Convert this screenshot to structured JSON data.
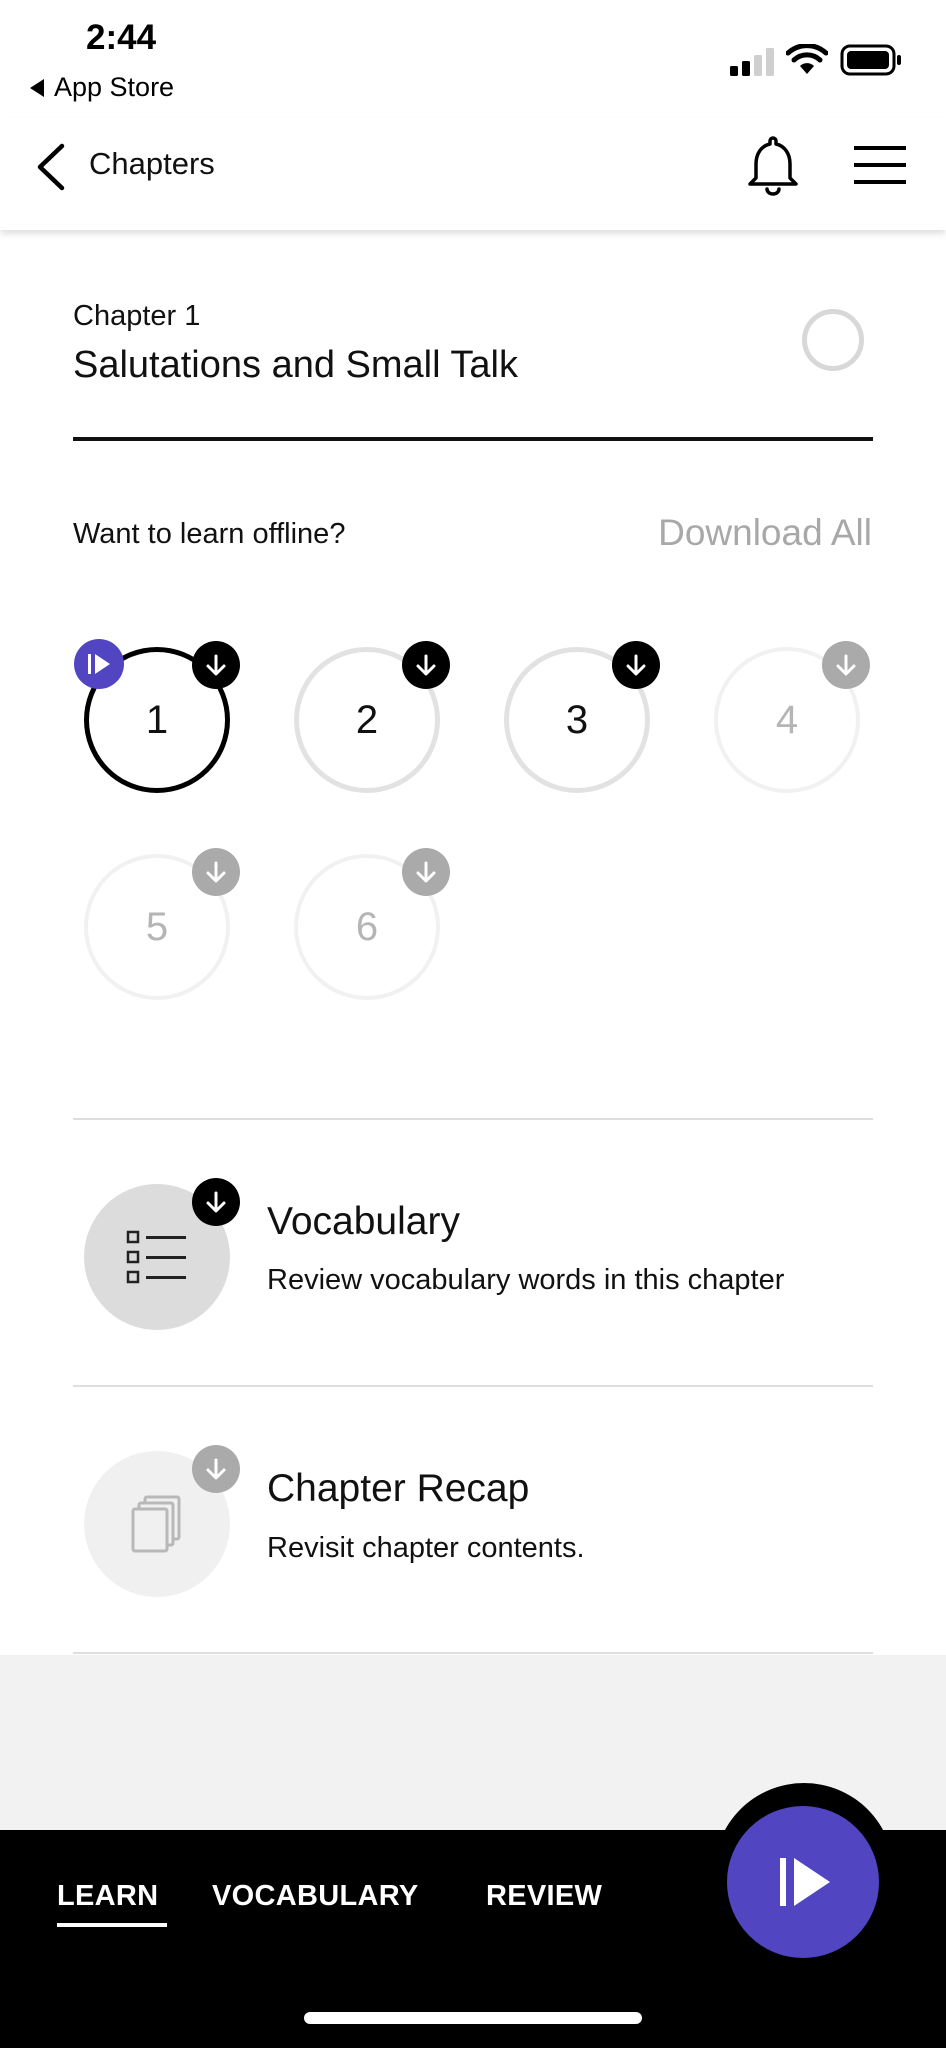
{
  "status_bar": {
    "time": "2:44",
    "back_app_label": "App Store",
    "icons": [
      "signal-icon",
      "wifi-icon",
      "battery-icon"
    ]
  },
  "header": {
    "back_label": "Chapters",
    "icons": [
      "chevron-left-icon",
      "bell-icon",
      "menu-icon"
    ]
  },
  "chapter": {
    "number_label": "Chapter 1",
    "title": "Salutations and Small Talk"
  },
  "offline": {
    "question": "Want to learn offline?",
    "download_all": "Download All"
  },
  "lessons": [
    {
      "label": "1",
      "state": "current",
      "download": "dark"
    },
    {
      "label": "2",
      "state": "available",
      "download": "dark"
    },
    {
      "label": "3",
      "state": "available",
      "download": "dark"
    },
    {
      "label": "4",
      "state": "locked",
      "download": "light"
    },
    {
      "label": "5",
      "state": "locked",
      "download": "light"
    },
    {
      "label": "6",
      "state": "locked",
      "download": "light"
    }
  ],
  "features": {
    "vocabulary": {
      "title": "Vocabulary",
      "description": "Review vocabulary words in this chapter"
    },
    "recap": {
      "title": "Chapter Recap",
      "description": "Revisit chapter contents."
    }
  },
  "bottom_nav": {
    "tabs": [
      "LEARN",
      "VOCABULARY",
      "REVIEW"
    ],
    "active_tab": "LEARN"
  },
  "colors": {
    "accent": "#5145c2",
    "nav_background": "#000000",
    "muted": "#a8a8a8"
  }
}
